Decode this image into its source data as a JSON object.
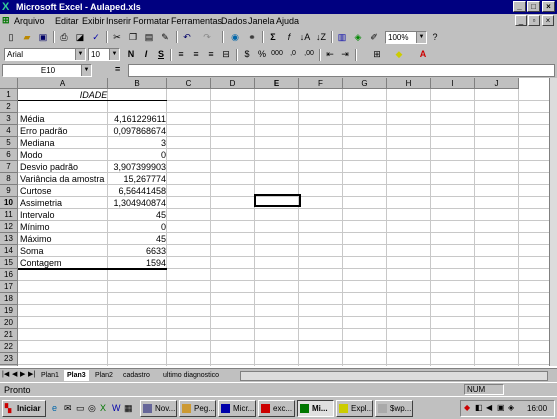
{
  "window": {
    "title": "Microsoft Excel - Aulaped.xls"
  },
  "menu": [
    "Arquivo",
    "Editar",
    "Exibir",
    "Inserir",
    "Formatar",
    "Ferramentas",
    "Dados",
    "Janela",
    "Ajuda"
  ],
  "toolbar": {
    "zoom": "100%"
  },
  "format": {
    "font": "Arial",
    "size": "10",
    "bold": "N",
    "italic": "I",
    "underline": "S"
  },
  "formula_bar": {
    "name_box": "E10",
    "eq": "=",
    "content": ""
  },
  "columns": [
    "A",
    "B",
    "C",
    "D",
    "E",
    "F",
    "G",
    "H",
    "I",
    "J"
  ],
  "rows": [
    "1",
    "2",
    "3",
    "4",
    "5",
    "6",
    "7",
    "8",
    "9",
    "10",
    "11",
    "12",
    "13",
    "14",
    "15",
    "16",
    "17",
    "18",
    "19",
    "20",
    "21",
    "22",
    "23",
    "24"
  ],
  "cells": {
    "A1": "IDADE",
    "labels": [
      "Média",
      "Erro padrão",
      "Mediana",
      "Modo",
      "Desvio padrão",
      "Variância da amostra",
      "Curtose",
      "Assimetria",
      "Intervalo",
      "Mínimo",
      "Máximo",
      "Soma",
      "Contagem"
    ],
    "values": [
      "4,161229611",
      "0,097868674",
      "3",
      "0",
      "3,907399903",
      "15,267774",
      "6,56441458",
      "1,304940874",
      "45",
      "0",
      "45",
      "6633",
      "1594"
    ]
  },
  "sheet_tabs": [
    "Plan1",
    "Plan3",
    "Plan2",
    "cadastro",
    "ultimo diagnostico"
  ],
  "active_tab": "Plan3",
  "status": {
    "left": "Pronto",
    "num": "NUM"
  },
  "taskbar": {
    "start": "Iniciar",
    "tasks": [
      "Nov...",
      "Peg...",
      "Micr...",
      "exc...",
      "Mi...",
      "Expl...",
      "$wp..."
    ],
    "clock": "16:00"
  }
}
